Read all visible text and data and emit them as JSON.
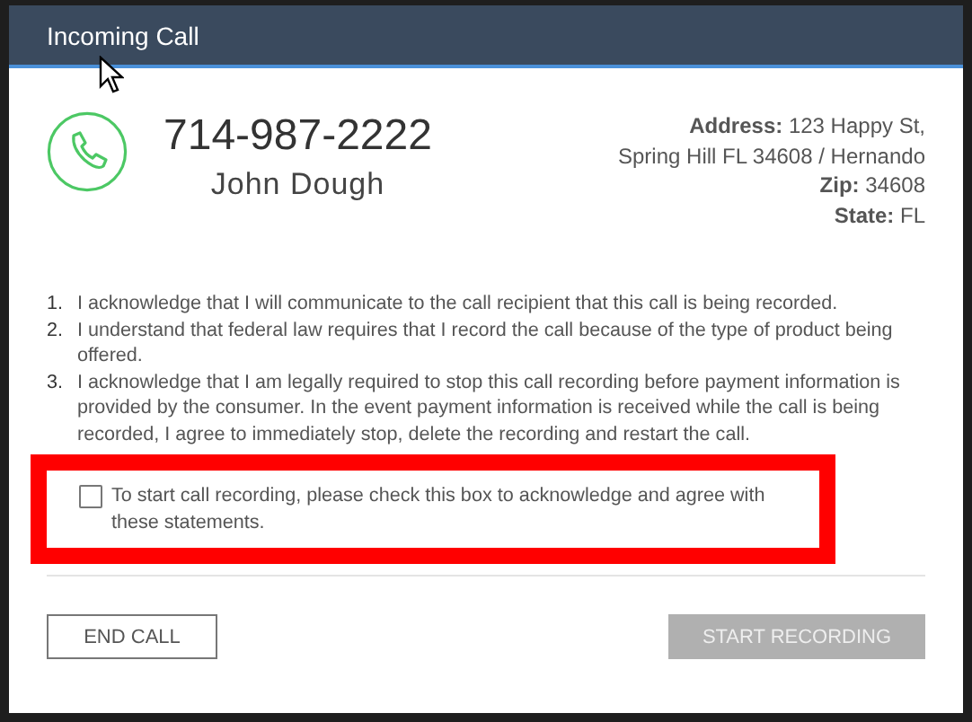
{
  "window": {
    "title": "Incoming Call"
  },
  "caller": {
    "phone": "714-987-2222",
    "name": "John Dough"
  },
  "address": {
    "lines": [
      "**Address:** 123 Happy St,",
      "Spring Hill FL 34608 / Hernando"
    ],
    "zip": "**Zip:** 34608",
    "state": "**State:** FL"
  },
  "statements": [
    {
      "number": "1.",
      "text": "I acknowledge that I will communicate to the call recipient that this call is being recorded."
    },
    {
      "number": "2.",
      "text": "I understand that federal law requires that I record the call because of the type of product being offered."
    },
    {
      "number": "3.",
      "text": "I acknowledge that I am legally required to stop this call recording before payment information is provided by the consumer. In the event payment information is received while the call is being recorded, I agree to immediately stop, delete the recording and restart the call."
    }
  ],
  "consent": {
    "label": "To start call recording, please check this box to acknowledge and agree with these statements.",
    "checked": false,
    "highlighted": true
  },
  "buttons": [
    {
      "label": "END CALL",
      "kind": "outline",
      "disabled": false
    },
    {
      "label": "START RECORDING",
      "kind": "primary",
      "disabled": true
    }
  ]
}
